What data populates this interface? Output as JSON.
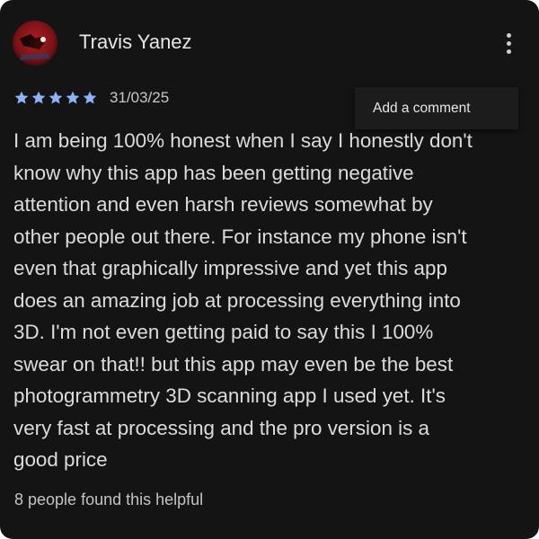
{
  "review": {
    "reviewer_name": "Travis Yanez",
    "rating": 5,
    "rating_max": 5,
    "date": "31/03/25",
    "body_lines": [
      "I am being 100% honest when I say I honestly don't",
      "know why this app has been getting negative",
      "attention and even harsh reviews somewhat by",
      "other people out there. For instance my phone isn't",
      "even that graphically impressive and yet this app",
      "does an amazing job at processing everything into",
      "3D. I'm not even getting paid to say this I 100%",
      "swear on that!! but this app may even be the best",
      "photogrammetry 3D scanning app I used yet. It's",
      "very fast at processing and the pro version is a",
      "good price"
    ],
    "helpful_text": "8 people found this helpful"
  },
  "menu": {
    "items": [
      {
        "label": "Add a comment"
      }
    ]
  },
  "icons": {
    "more": "more-vert-icon",
    "star": "star-icon",
    "avatar": "avatar-image"
  },
  "colors": {
    "background": "#141414",
    "star": "#8ab4f8",
    "text": "#dcdcdc",
    "menu_background": "#1c1c1c"
  }
}
